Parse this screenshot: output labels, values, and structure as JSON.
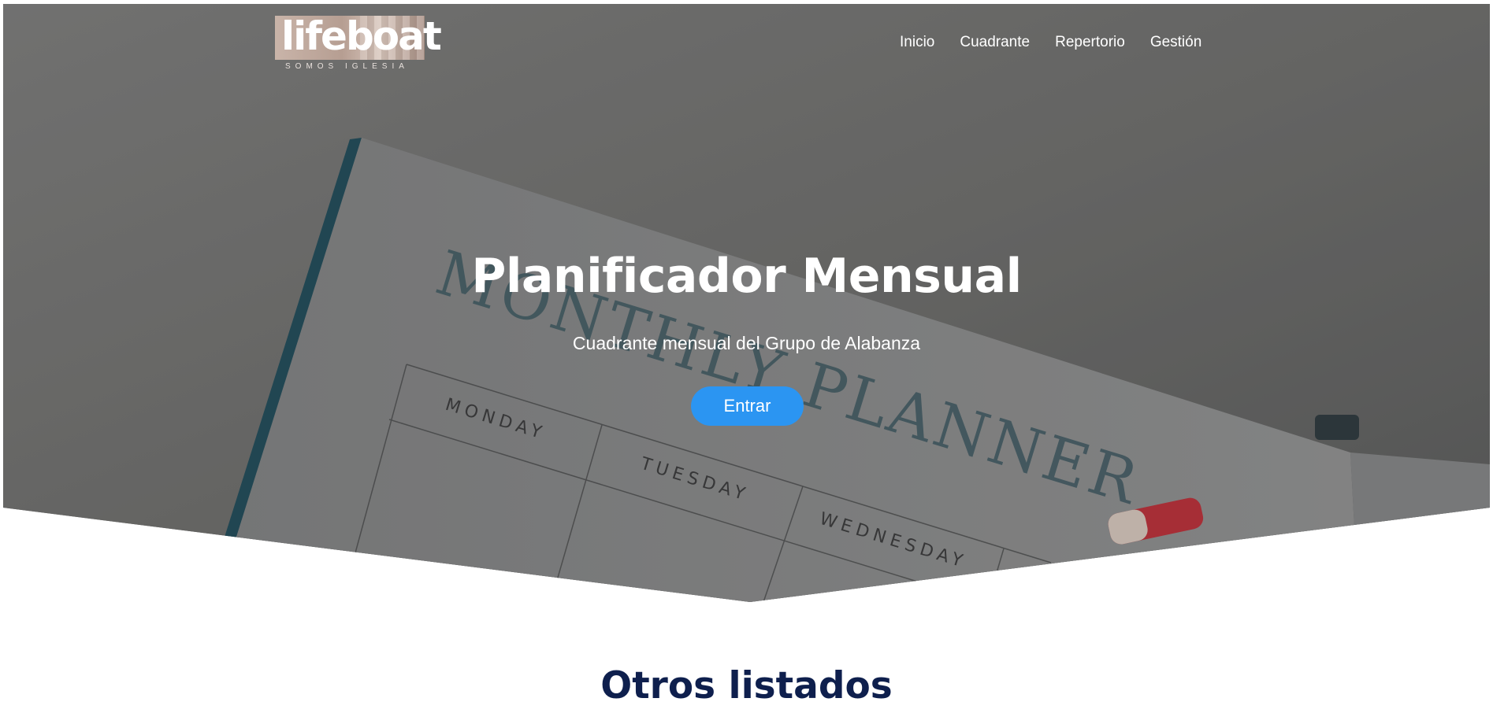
{
  "brand": {
    "logo_text": "lifeboat",
    "tagline": "SOMOS IGLESIA"
  },
  "nav": {
    "items": [
      {
        "label": "Inicio"
      },
      {
        "label": "Cuadrante"
      },
      {
        "label": "Repertorio"
      },
      {
        "label": "Gestión"
      }
    ]
  },
  "hero": {
    "title": "Planificador Mensual",
    "subtitle": "Cuadrante mensual del Grupo de Alabanza",
    "button_label": "Entrar",
    "photo": {
      "heading": "MONTHLY PLANNER",
      "days": [
        "MONDAY",
        "TUESDAY",
        "WEDNESDAY"
      ]
    }
  },
  "section": {
    "title": "Otros listados"
  },
  "colors": {
    "accent_button": "#2b95f2",
    "section_title": "#0e1f4d",
    "nav_text": "#ffffff"
  }
}
